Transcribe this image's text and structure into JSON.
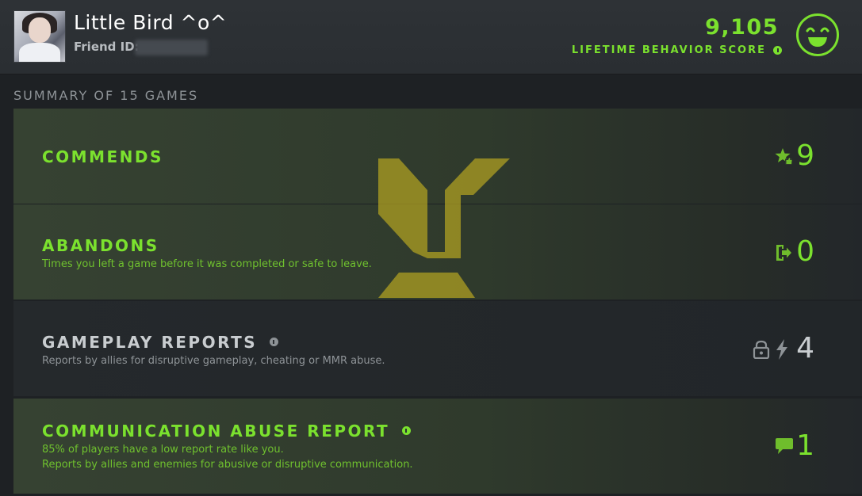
{
  "header": {
    "player_name": "Little Bird ^o^",
    "friend_id_label": "Friend ID:",
    "friend_id_value": "",
    "score": "9,105",
    "score_label": "LIFETIME BEHAVIOR SCORE"
  },
  "summary_title": "SUMMARY OF 15 GAMES",
  "rows": [
    {
      "title": "COMMENDS",
      "value": "9",
      "desc": []
    },
    {
      "title": "ABANDONS",
      "value": "0",
      "desc": [
        "Times you left a game before it was completed or safe to leave."
      ]
    },
    {
      "title": "GAMEPLAY REPORTS",
      "value": "4",
      "desc": [
        "Reports by allies for disruptive gameplay, cheating or MMR abuse."
      ]
    },
    {
      "title": "COMMUNICATION ABUSE REPORT",
      "value": "1",
      "desc": [
        "85% of players have a low report rate like you.",
        "Reports by allies and enemies for abusive or disruptive communication."
      ]
    }
  ],
  "icons": {
    "score": "smiley-face-icon",
    "commends": "star-thumbs-up-icon",
    "abandons": "exit-door-icon",
    "gameplay_lock": "lock-icon",
    "gameplay": "lightning-icon",
    "communication": "chat-bubble-icon",
    "info": "info-icon"
  },
  "colors": {
    "accent_green": "#7be12e",
    "green_desc": "#6fc12e",
    "gray_title": "#c9cdd0",
    "gray_desc": "#8e9397",
    "watermark": "#b3a321"
  }
}
